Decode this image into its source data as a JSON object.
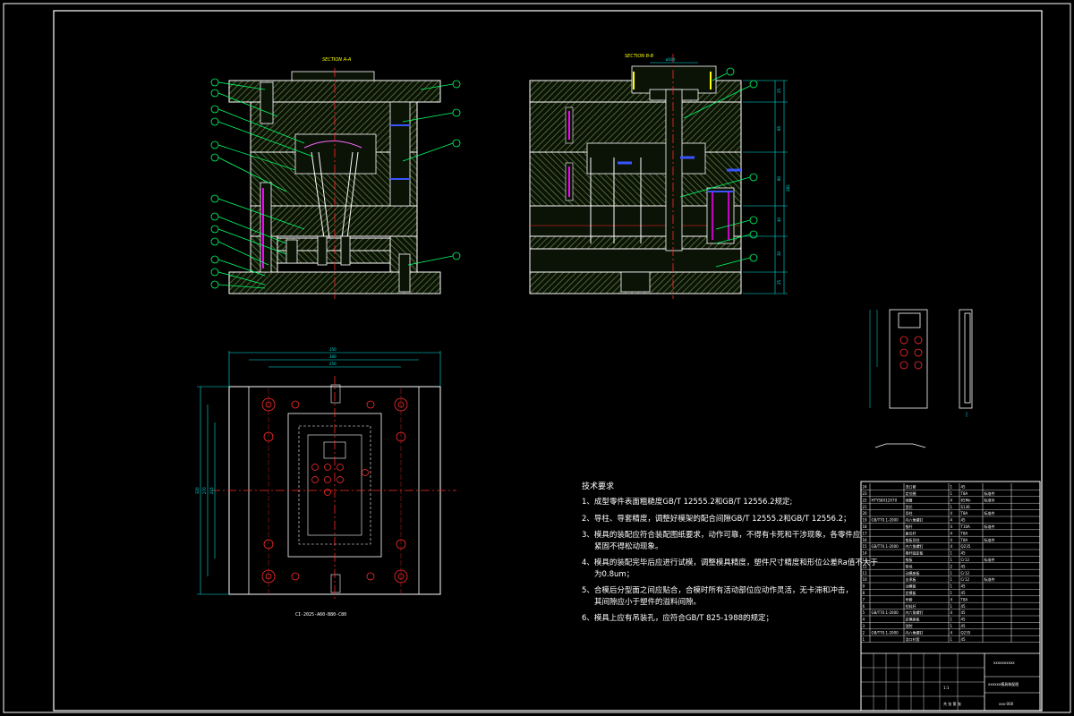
{
  "drawing": {
    "section_a_title": "SECTION A-A",
    "section_b_title": "SECTION B-B",
    "plan_caption": "CI-2025-A60-B80-C80",
    "dim_labels": [
      "350",
      "300",
      "250",
      "320",
      "270",
      "215",
      "ø104",
      "25",
      "85",
      "80",
      "40",
      "30",
      "25",
      "282"
    ],
    "colors": {
      "background": "#000000",
      "outline": "#ffffff",
      "hatch": "#4e6b3a",
      "dimension": "#00e5e5",
      "centerline": "#ff2a2a",
      "accent_blue": "#3a55ff",
      "accent_magenta": "#ff00ff",
      "balloon": "#00ff66",
      "title_yellow": "#ffff00"
    }
  },
  "technical_requirements": {
    "heading": "技术要求",
    "items": [
      "1、成型零件表面粗糙度GB/T 12555.2和GB/T 12556.2规定;",
      "2、导柱、导套精度，调整好模架的配合间隙GB/T 12555.2和GB/T 12556.2；",
      "3、模具的装配应符合装配图纸要求，动作可靠，不得有卡死和干涉现象，各零件应",
      "4、模具的装配完毕后应进行试模，调整模具精度，塑件尺寸精度和形位公差Ra值不大于",
      "5、合模后分型面之间应贴合，合模时所有活动部位应动作灵活，无卡滞和冲击，",
      "6、模具上应有吊装孔，应符合GB/T 825-1988的规定；"
    ],
    "continuations": {
      "3": "紧固不得松动现象。",
      "4": "为0.8um；",
      "5": "其间隙应小于塑件的溢料间隙。"
    }
  },
  "title_block": {
    "rows": [
      {
        "no": "24",
        "code": "",
        "name": "浇口套",
        "qty": "1",
        "material": "45",
        "note": ""
      },
      {
        "no": "23",
        "code": "",
        "name": "定位圈",
        "qty": "1",
        "material": "T8A",
        "note": "标准件"
      },
      {
        "no": "22",
        "code": "HTYS8X12X70",
        "name": "弹簧",
        "qty": "4",
        "material": "65Mn",
        "note": "标准件"
      },
      {
        "no": "21",
        "code": "",
        "name": "型芯",
        "qty": "1",
        "material": "S136",
        "note": ""
      },
      {
        "no": "20",
        "code": "",
        "name": "导柱",
        "qty": "4",
        "material": "T8A",
        "note": "标准件"
      },
      {
        "no": "19",
        "code": "GB/T70.1-2000",
        "name": "内六角螺钉",
        "qty": "4",
        "material": "45",
        "note": ""
      },
      {
        "no": "18",
        "code": "",
        "name": "推杆",
        "qty": "4",
        "material": "T10A",
        "note": "标准件"
      },
      {
        "no": "17",
        "code": "",
        "name": "复位杆",
        "qty": "4",
        "material": "T8A",
        "note": ""
      },
      {
        "no": "16",
        "code": "",
        "name": "推板导柱",
        "qty": "4",
        "material": "T8A",
        "note": "标准件"
      },
      {
        "no": "15",
        "code": "GB/T70.1-2000",
        "name": "内六角螺钉",
        "qty": "4",
        "material": "Q235",
        "note": ""
      },
      {
        "no": "14",
        "code": "",
        "name": "推杆固定板",
        "qty": "1",
        "material": "45",
        "note": ""
      },
      {
        "no": "13",
        "code": "",
        "name": "推板",
        "qty": "1",
        "material": "Cr12",
        "note": "标准件"
      },
      {
        "no": "12",
        "code": "",
        "name": "垫块",
        "qty": "2",
        "material": "45",
        "note": ""
      },
      {
        "no": "11",
        "code": "",
        "name": "动模座板",
        "qty": "1",
        "material": "Cr12",
        "note": ""
      },
      {
        "no": "10",
        "code": "",
        "name": "支承板",
        "qty": "1",
        "material": "Cr12",
        "note": "标准件"
      },
      {
        "no": "9",
        "code": "",
        "name": "动模板",
        "qty": "1",
        "material": "45",
        "note": ""
      },
      {
        "no": "8",
        "code": "",
        "name": "定模板",
        "qty": "1",
        "material": "45",
        "note": ""
      },
      {
        "no": "7",
        "code": "",
        "name": "导套",
        "qty": "4",
        "material": "T8A",
        "note": ""
      },
      {
        "no": "6",
        "code": "",
        "name": "拉料杆",
        "qty": "1",
        "material": "45",
        "note": ""
      },
      {
        "no": "5",
        "code": "GB/T70.1-2000",
        "name": "内六角螺钉",
        "qty": "4",
        "material": "45",
        "note": ""
      },
      {
        "no": "4",
        "code": "",
        "name": "定模座板",
        "qty": "1",
        "material": "45",
        "note": ""
      },
      {
        "no": "3",
        "code": "",
        "name": "型腔",
        "qty": "1",
        "material": "45",
        "note": ""
      },
      {
        "no": "2",
        "code": "GB/T70.1-2000",
        "name": "内六角螺钉",
        "qty": "4",
        "material": "Q235",
        "note": ""
      },
      {
        "no": "1",
        "code": "",
        "name": "浇口衬套",
        "qty": "1",
        "material": "45",
        "note": ""
      }
    ],
    "company": "xxxxxxxxxx",
    "drawing_name": "xxxxxx模具装配图",
    "drawing_number": "xxx-000",
    "scale": "1:1",
    "sheet": "共 张 第 张"
  }
}
